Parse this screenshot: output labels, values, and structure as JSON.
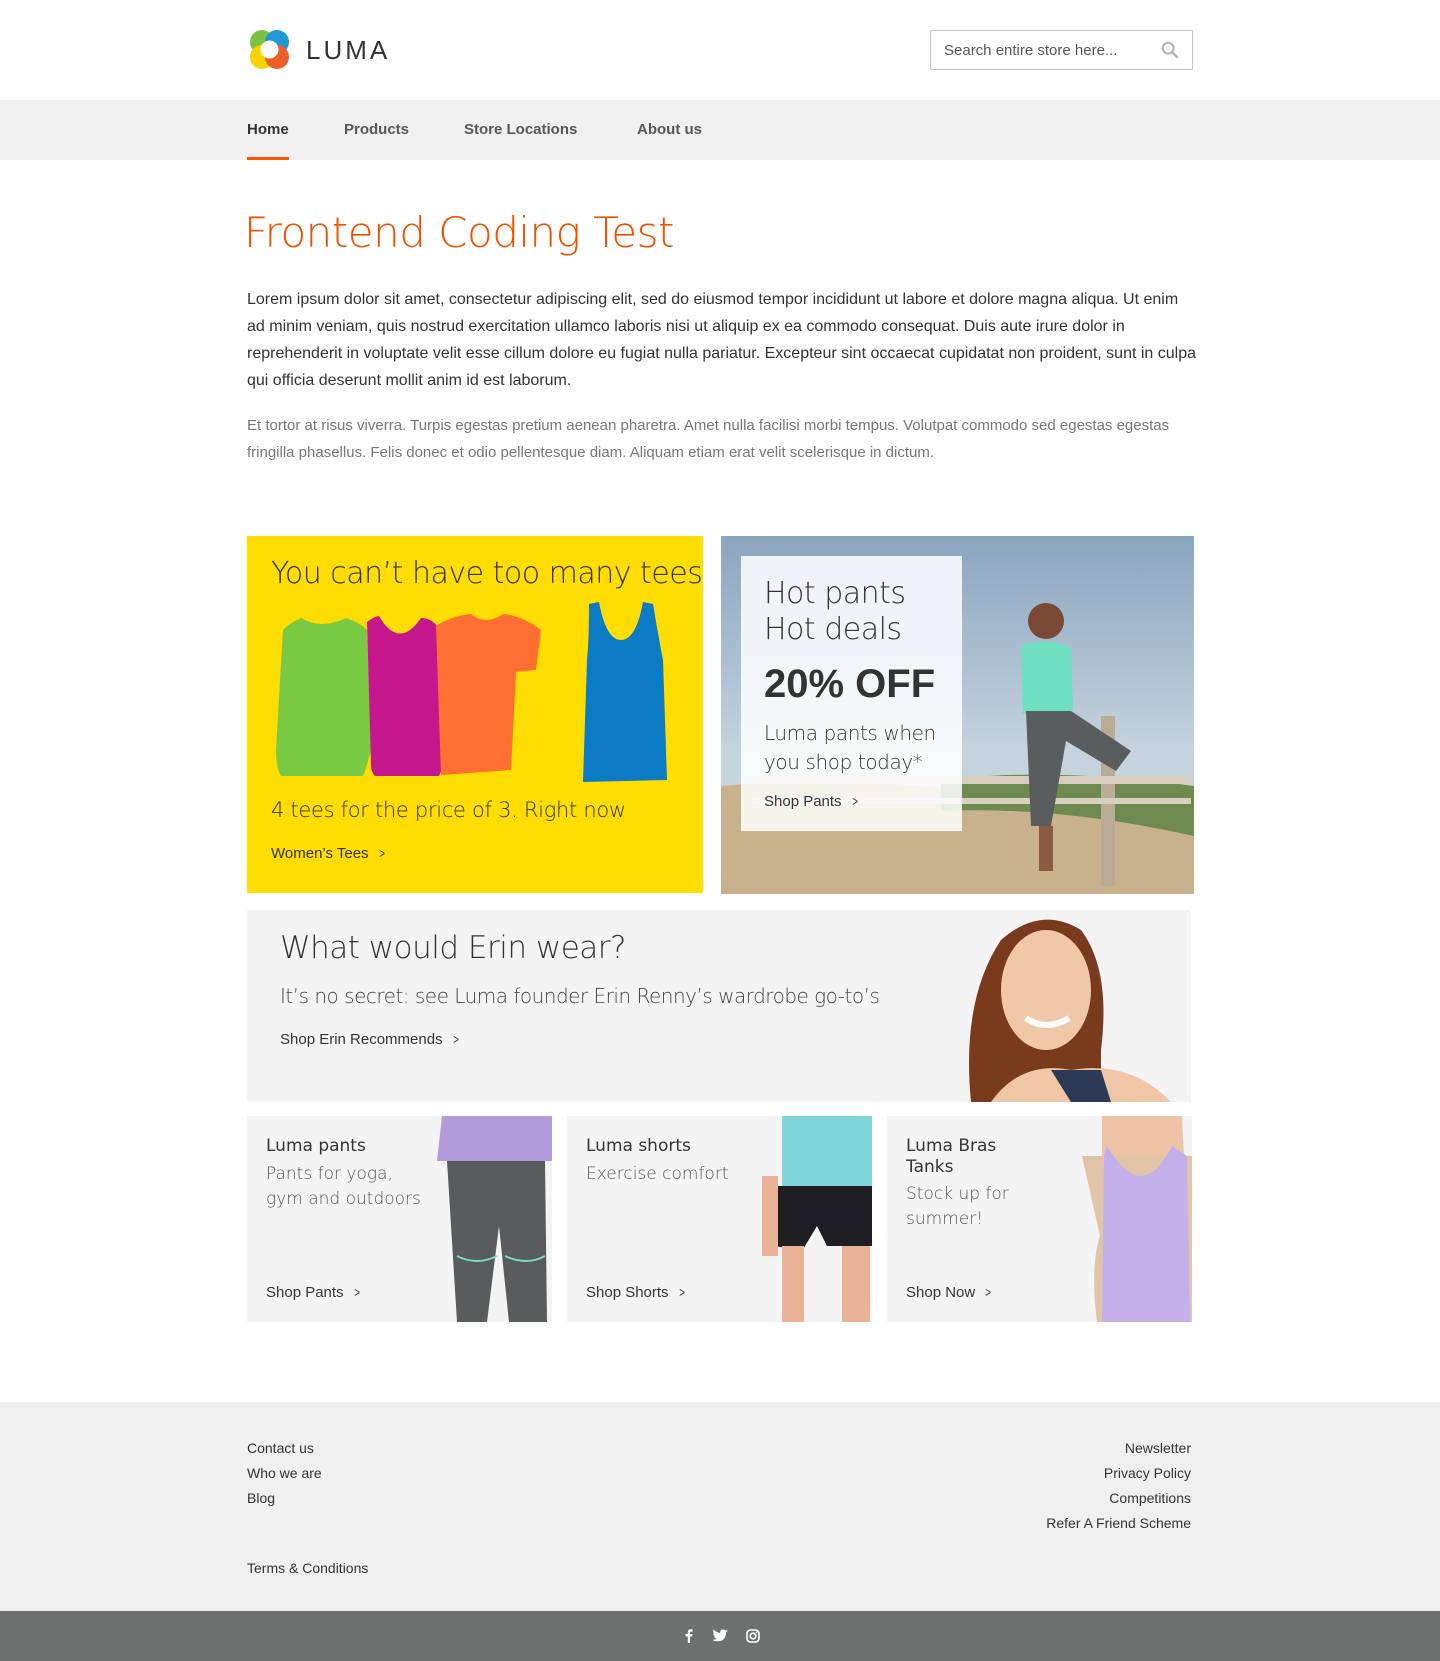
{
  "header": {
    "logo_text": "LUMA",
    "search_placeholder": "Search entire store here..."
  },
  "nav": {
    "items": [
      {
        "label": "Home",
        "active": true
      },
      {
        "label": "Products",
        "active": false
      },
      {
        "label": "Store Locations",
        "active": false
      },
      {
        "label": "About us",
        "active": false
      }
    ]
  },
  "main": {
    "title": "Frontend Coding Test",
    "lead": "Lorem ipsum dolor sit amet, consectetur adipiscing elit, sed do eiusmod tempor incididunt ut labore et dolore magna aliqua. Ut enim ad minim veniam, quis nostrud exercitation ullamco laboris nisi ut aliquip ex ea commodo consequat. Duis aute irure dolor in reprehenderit in voluptate velit esse cillum dolore eu fugiat nulla pariatur. Excepteur sint occaecat cupidatat non proident, sunt in culpa qui officia deserunt mollit anim id est laborum.",
    "sub": "Et tortor at risus viverra. Turpis egestas pretium aenean pharetra. Amet nulla facilisi morbi tempus. Volutpat commodo sed egestas egestas fringilla phasellus. Felis donec et odio pellentesque diam. Aliquam etiam erat velit scelerisque in dictum."
  },
  "promo_tees": {
    "heading": "You can’t have too many tees",
    "text": "4 tees for the price of 3. Right now",
    "link": "Women’s Tees"
  },
  "promo_pants": {
    "heading_line1": "Hot pants",
    "heading_line2": "Hot deals",
    "offer": "20% OFF",
    "text": "Luma pants when you shop today*",
    "link": "Shop Pants"
  },
  "erin": {
    "heading": "What would Erin wear?",
    "text": "It’s no secret: see Luma founder Erin Renny’s wardrobe go-to’s",
    "link": "Shop Erin Recommends"
  },
  "tiles": [
    {
      "heading": "Luma pants",
      "text": "Pants for yoga, gym and outdoors",
      "link": "Shop Pants"
    },
    {
      "heading": "Luma shorts",
      "text": "Exercise comfort",
      "link": "Shop Shorts"
    },
    {
      "heading": "Luma Bras Tanks",
      "text": "Stock up for summer!",
      "link": "Shop Now"
    }
  ],
  "footer": {
    "left_links": [
      "Contact us",
      "Who we are",
      "Blog"
    ],
    "right_links": [
      "Newsletter",
      "Privacy Policy",
      "Competitions",
      "Refer A Friend Scheme"
    ],
    "terms": "Terms & Conditions",
    "social_icons": [
      "facebook-icon",
      "twitter-icon",
      "instagram-icon"
    ]
  },
  "colors": {
    "accent": "#eb5202",
    "promo_yellow": "#ffdd00",
    "nav_bg": "#f0f0f0",
    "footer_bar": "#6e716f"
  }
}
